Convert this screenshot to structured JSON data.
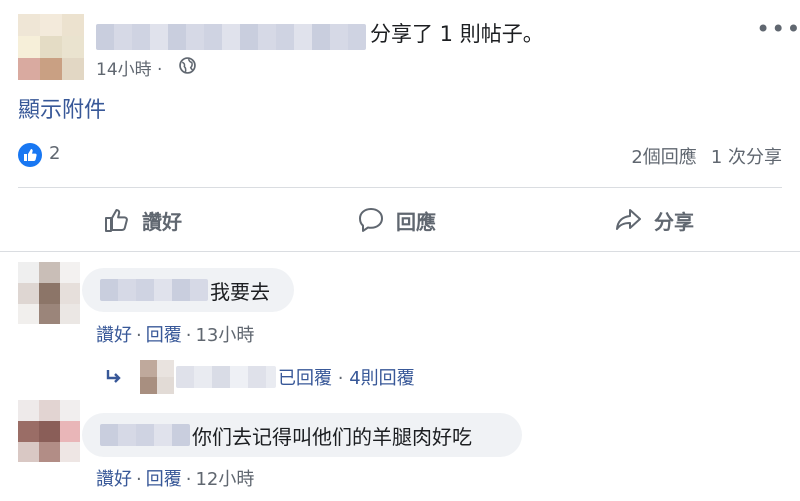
{
  "post": {
    "shared_text": "分享了 1 則帖子。",
    "time": "14小時 ·",
    "attachment_link": "顯示附件",
    "like_count": "2",
    "comment_count": "2個回應",
    "share_count": "1 次分享"
  },
  "actions": {
    "like": "讚好",
    "comment": "回應",
    "share": "分享"
  },
  "comments": [
    {
      "text": "我要去",
      "like": "讚好",
      "reply": "回覆",
      "time": "13小時"
    },
    {
      "text": "你们去记得叫他们的羊腿肉好吃",
      "like": "讚好",
      "reply": "回覆",
      "time": "12小時"
    }
  ],
  "reply_summary": {
    "replied": "已回覆",
    "count": "4則回覆"
  },
  "separator": "·",
  "icons": [
    "globe-icon",
    "more-options-icon",
    "like-reaction-icon",
    "thumbs-up-icon",
    "comment-icon",
    "share-arrow-icon",
    "reply-arrow-icon"
  ],
  "colors": {
    "link": "#385898",
    "meta": "#606770",
    "like_blue": "#1877f2",
    "bubble": "#f0f2f5"
  }
}
